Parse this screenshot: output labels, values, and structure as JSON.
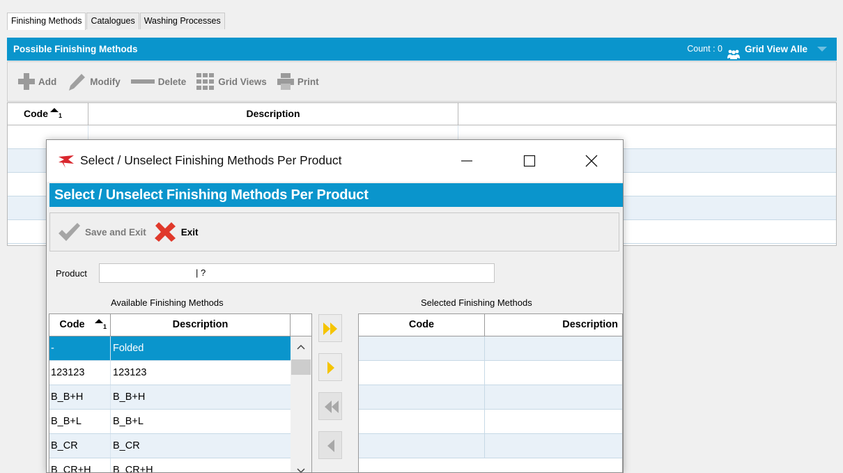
{
  "tabs": [
    {
      "label": "Finishing Methods",
      "active": true
    },
    {
      "label": "Catalogues",
      "active": false
    },
    {
      "label": "Washing Processes",
      "active": false
    }
  ],
  "main": {
    "header_title": "Possible Finishing Methods",
    "count_text": "Count : 0",
    "grid_view_label": "Grid View Alle",
    "toolbar": {
      "add": "Add",
      "modify": "Modify",
      "delete": "Delete",
      "grid_views": "Grid Views",
      "print": "Print"
    },
    "grid": {
      "columns": [
        "Code",
        "Description"
      ],
      "sort_indicator": "1"
    }
  },
  "dialog": {
    "window_title": "Select / Unselect Finishing Methods Per Product",
    "header_title": "Select / Unselect Finishing Methods Per Product",
    "toolbar": {
      "save_exit": "Save and Exit",
      "exit": "Exit"
    },
    "product_label": "Product",
    "product_value": "| ?",
    "available_label": "Available Finishing Methods",
    "selected_label": "Selected Finishing Methods",
    "available": {
      "columns": [
        "Code",
        "Description"
      ],
      "sort_indicator": "1",
      "rows": [
        {
          "code": "-",
          "description": "Folded",
          "selected": true
        },
        {
          "code": "123123",
          "description": "123123"
        },
        {
          "code": "B_B+H",
          "description": "B_B+H"
        },
        {
          "code": "B_B+L",
          "description": "B_B+L"
        },
        {
          "code": "B_CR",
          "description": "B_CR"
        },
        {
          "code": "B_CR+H",
          "description": "B_CR+H"
        }
      ]
    },
    "selected": {
      "columns": [
        "Code",
        "Description"
      ]
    }
  },
  "colors": {
    "accent": "#0a95cc",
    "exit_red": "#e0392b",
    "move_yellow": "#f5c400"
  }
}
